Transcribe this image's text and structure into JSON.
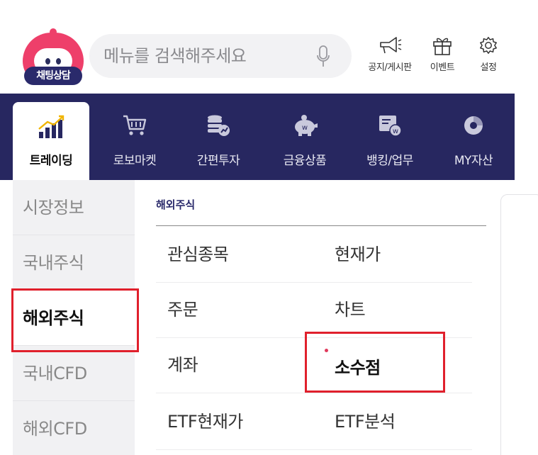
{
  "colors": {
    "brand_navy": "#272760",
    "accent_pink": "#ee3f6a",
    "highlight_red": "#e0202c"
  },
  "chatbot": {
    "badge": "채팅상담",
    "icon": "robot-icon"
  },
  "search": {
    "placeholder": "메뉴를 검색해주세요",
    "icon": "microphone-icon"
  },
  "header_icons": [
    {
      "label": "공지/게시판",
      "icon": "megaphone-icon"
    },
    {
      "label": "이벤트",
      "icon": "gift-icon"
    },
    {
      "label": "설정",
      "icon": "gear-icon"
    }
  ],
  "nav": {
    "active": "트레이딩",
    "tabs": [
      {
        "label": "트레이딩",
        "icon": "chart-growth-icon"
      },
      {
        "label": "로보마켓",
        "icon": "cart-icon"
      },
      {
        "label": "간편투자",
        "icon": "coins-icon"
      },
      {
        "label": "금융상품",
        "icon": "piggybank-icon"
      },
      {
        "label": "뱅킹/업무",
        "icon": "banking-icon"
      },
      {
        "label": "MY자산",
        "icon": "donut-icon"
      }
    ]
  },
  "sidebar": {
    "active": "해외주식",
    "items": [
      "시장정보",
      "국내주식",
      "해외주식",
      "국내CFD",
      "해외CFD"
    ]
  },
  "main": {
    "section_title": "해외주식",
    "rows": [
      [
        "관심종목",
        "현재가"
      ],
      [
        "주문",
        "차트"
      ],
      [
        "계좌",
        "소수점"
      ],
      [
        "ETF현재가",
        "ETF분석"
      ]
    ],
    "new_badge_item": "소수점"
  }
}
